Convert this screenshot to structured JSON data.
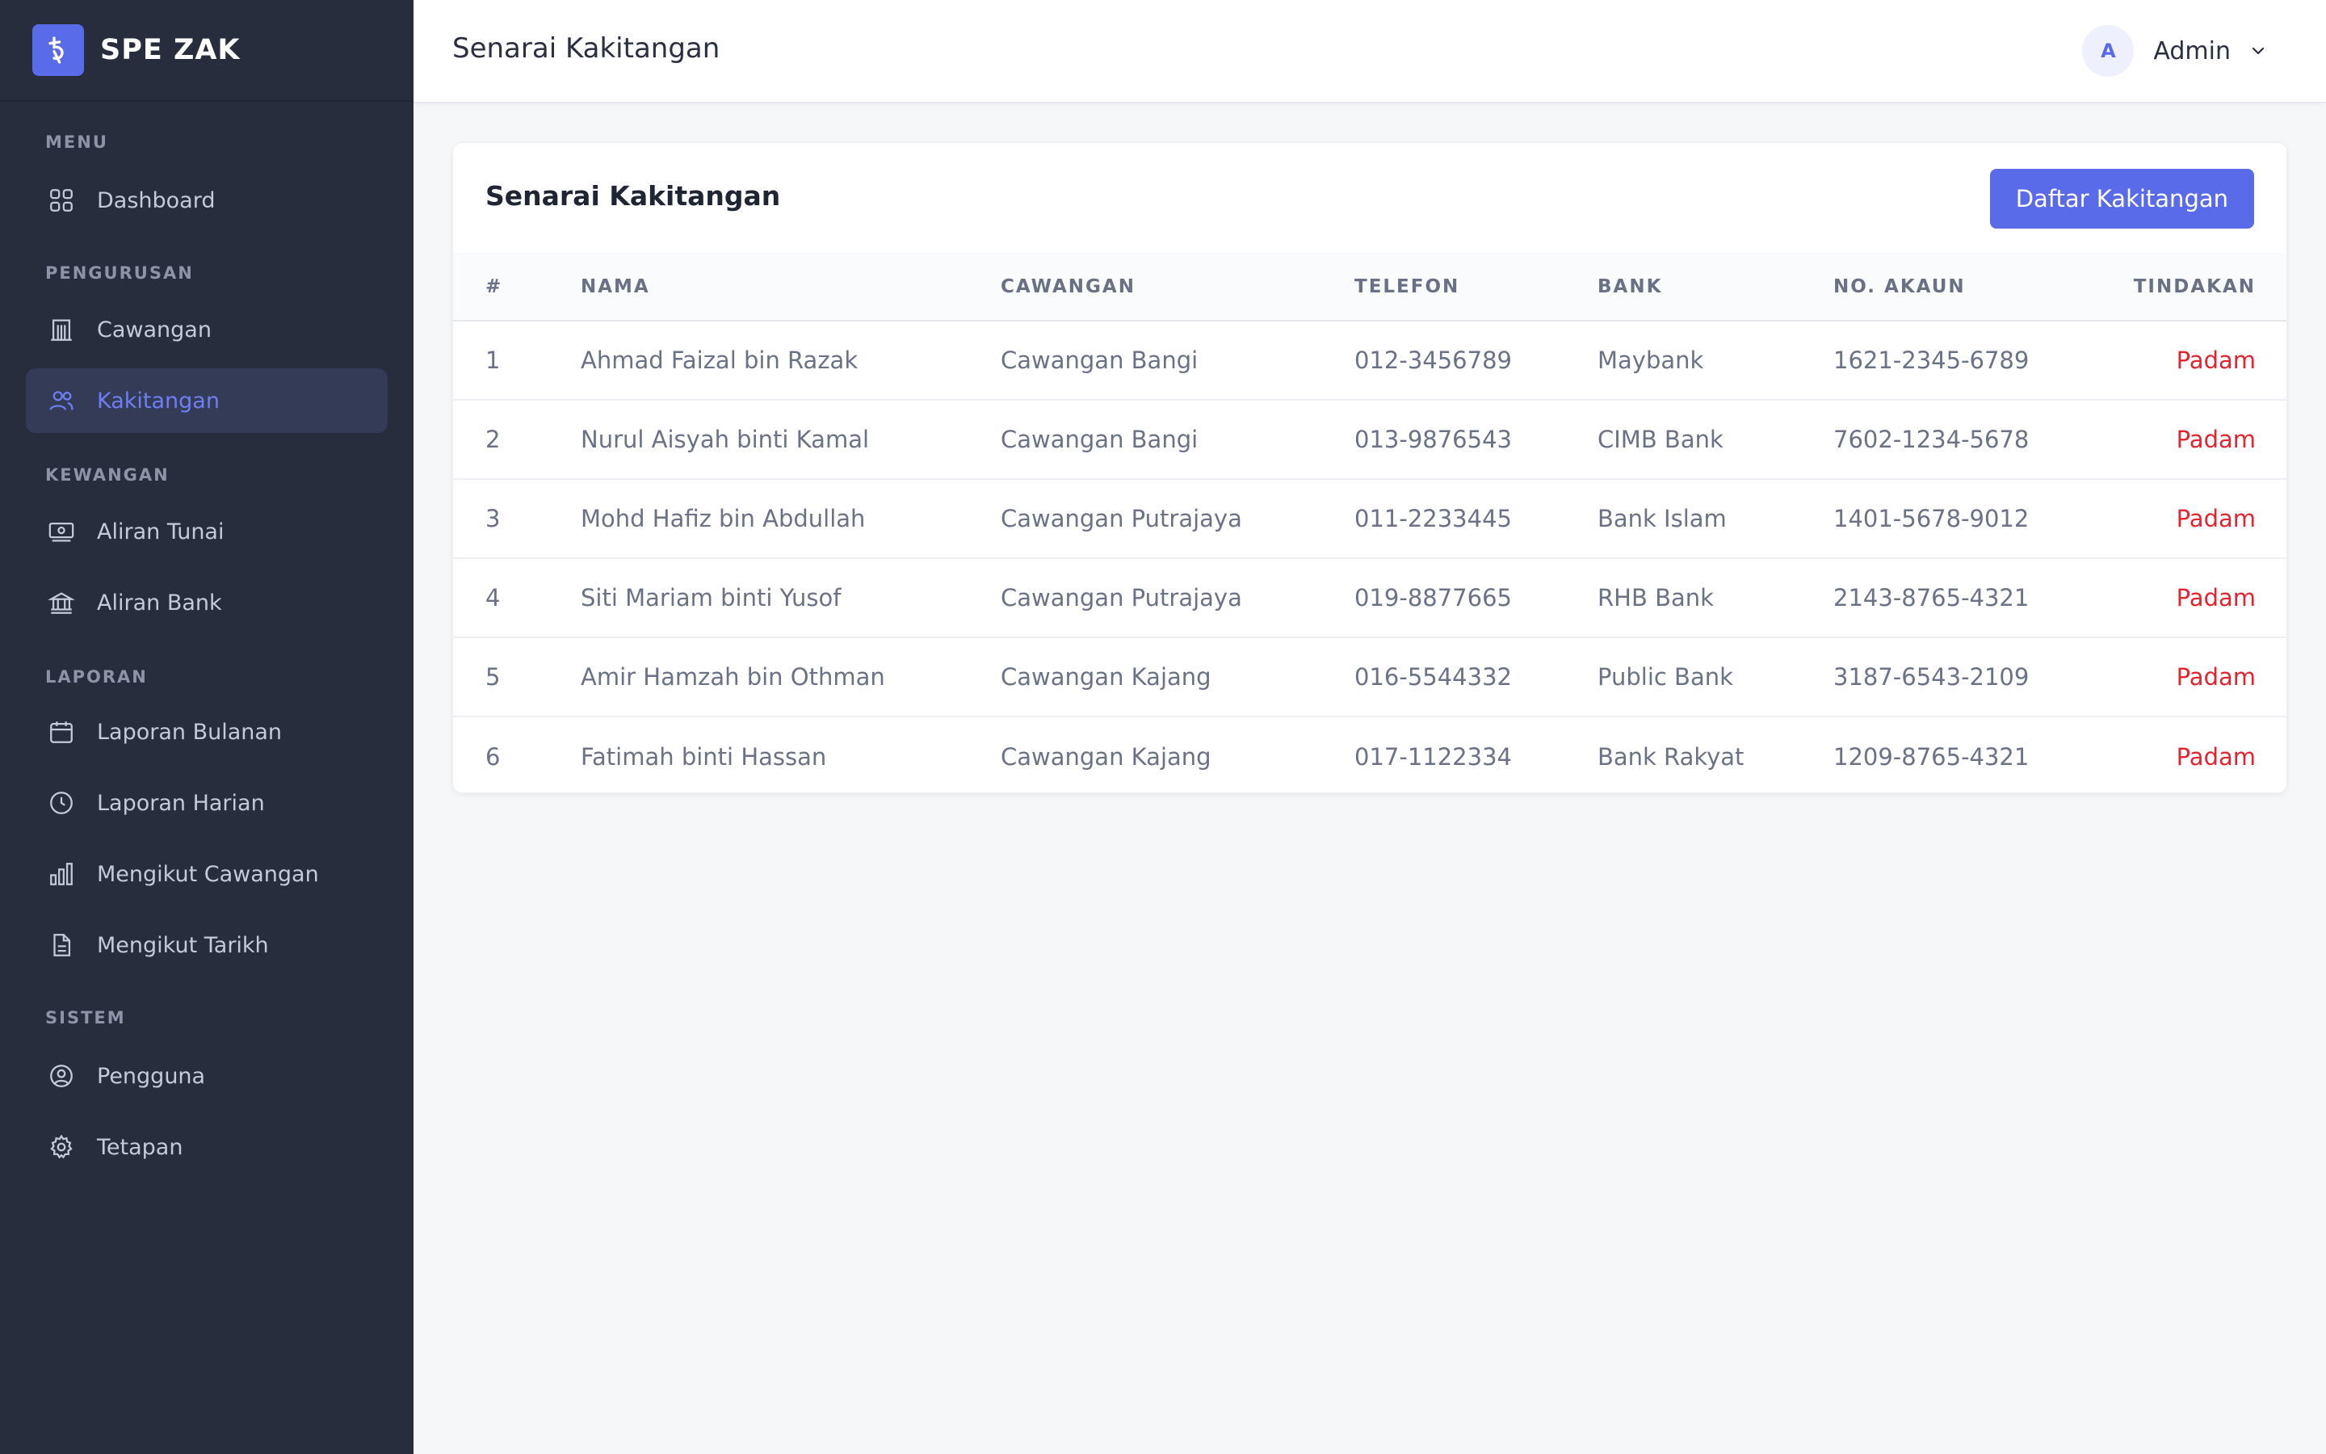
{
  "brand": {
    "name": "SPE ZAK"
  },
  "sidebar": {
    "sections": [
      {
        "title": "MENU"
      },
      {
        "title": "PENGURUSAN"
      },
      {
        "title": "KEWANGAN"
      },
      {
        "title": "LAPORAN"
      },
      {
        "title": "SISTEM"
      }
    ],
    "items": [
      {
        "label": "Dashboard",
        "icon": "grid-icon"
      },
      {
        "label": "Cawangan",
        "icon": "building-icon"
      },
      {
        "label": "Kakitangan",
        "icon": "users-icon",
        "active": true
      },
      {
        "label": "Aliran Tunai",
        "icon": "cash-icon"
      },
      {
        "label": "Aliran Bank",
        "icon": "bank-icon"
      },
      {
        "label": "Laporan Bulanan",
        "icon": "calendar-icon"
      },
      {
        "label": "Laporan Harian",
        "icon": "clock-icon"
      },
      {
        "label": "Mengikut Cawangan",
        "icon": "bar-chart-icon"
      },
      {
        "label": "Mengikut Tarikh",
        "icon": "document-icon"
      },
      {
        "label": "Pengguna",
        "icon": "user-circle-icon"
      },
      {
        "label": "Tetapan",
        "icon": "gear-icon"
      }
    ]
  },
  "header": {
    "title": "Senarai Kakitangan",
    "user": {
      "initial": "A",
      "name": "Admin"
    }
  },
  "card": {
    "title": "Senarai Kakitangan",
    "add_button": "Daftar Kakitangan"
  },
  "table": {
    "columns": [
      "#",
      "NAMA",
      "CAWANGAN",
      "TELEFON",
      "BANK",
      "NO. AKAUN",
      "TINDAKAN"
    ],
    "rows": [
      {
        "num": "1",
        "name": "Ahmad Faizal bin Razak",
        "branch": "Cawangan Bangi",
        "phone": "012-3456789",
        "bank": "Maybank",
        "account": "1621-2345-6789",
        "action": "Padam"
      },
      {
        "num": "2",
        "name": "Nurul Aisyah binti Kamal",
        "branch": "Cawangan Bangi",
        "phone": "013-9876543",
        "bank": "CIMB Bank",
        "account": "7602-1234-5678",
        "action": "Padam"
      },
      {
        "num": "3",
        "name": "Mohd Hafiz bin Abdullah",
        "branch": "Cawangan Putrajaya",
        "phone": "011-2233445",
        "bank": "Bank Islam",
        "account": "1401-5678-9012",
        "action": "Padam"
      },
      {
        "num": "4",
        "name": "Siti Mariam binti Yusof",
        "branch": "Cawangan Putrajaya",
        "phone": "019-8877665",
        "bank": "RHB Bank",
        "account": "2143-8765-4321",
        "action": "Padam"
      },
      {
        "num": "5",
        "name": "Amir Hamzah bin Othman",
        "branch": "Cawangan Kajang",
        "phone": "016-5544332",
        "bank": "Public Bank",
        "account": "3187-6543-2109",
        "action": "Padam"
      },
      {
        "num": "6",
        "name": "Fatimah binti Hassan",
        "branch": "Cawangan Kajang",
        "phone": "017-1122334",
        "bank": "Bank Rakyat",
        "account": "1209-8765-4321",
        "action": "Padam"
      }
    ]
  },
  "colors": {
    "sidebar_bg": "#282d3e",
    "accent": "#5a6bea",
    "danger": "#e32430",
    "page_bg": "#f6f7f9"
  }
}
